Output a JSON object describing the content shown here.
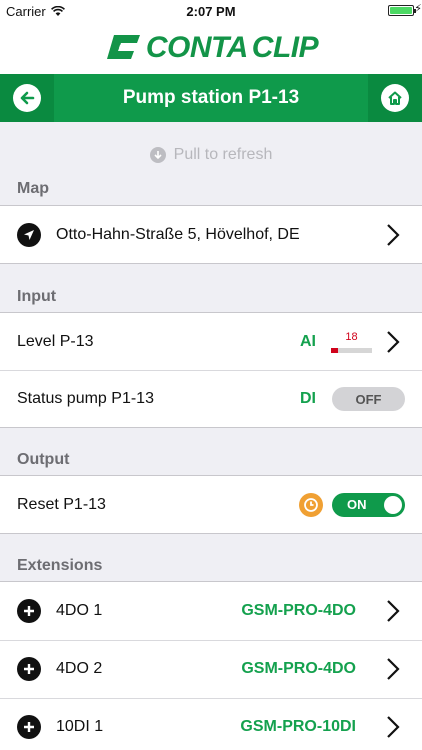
{
  "status_bar": {
    "carrier": "Carrier",
    "time": "2:07 PM"
  },
  "brand": {
    "logo_text_1": "CONTA",
    "logo_text_2": "CLIP",
    "color": "#139448"
  },
  "nav": {
    "title": "Pump station P1-13",
    "back_icon": "arrow-left-icon",
    "home_icon": "home-icon",
    "color": "#0f9a4b"
  },
  "refresh": {
    "label": "Pull to refresh"
  },
  "sections": {
    "map": {
      "header": "Map",
      "address": "Otto-Hahn-Straße 5, Hövelhof, DE"
    },
    "input": {
      "header": "Input",
      "rows": [
        {
          "label": "Level P-13",
          "type": "AI",
          "value": "18",
          "level_fraction": 0.18
        },
        {
          "label": "Status pump P1-13",
          "type": "DI",
          "state": "OFF"
        }
      ]
    },
    "output": {
      "header": "Output",
      "rows": [
        {
          "label": "Reset P1-13",
          "state": "ON"
        }
      ]
    },
    "extensions": {
      "header": "Extensions",
      "rows": [
        {
          "label": "4DO 1",
          "module": "GSM-PRO-4DO"
        },
        {
          "label": "4DO 2",
          "module": "GSM-PRO-4DO"
        },
        {
          "label": "10DI 1",
          "module": "GSM-PRO-10DI"
        }
      ]
    }
  }
}
